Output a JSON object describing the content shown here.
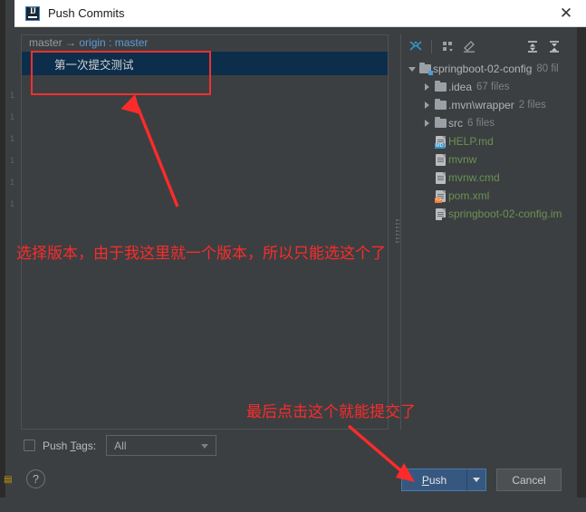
{
  "window": {
    "title": "Push Commits",
    "app_icon": "intellij-idea-icon",
    "close_label": "✕"
  },
  "commits_panel": {
    "branch_source": "master",
    "branch_arrow": "→",
    "branch_target": "origin : master",
    "commits": [
      {
        "message": "第一次提交测试",
        "selected": true
      }
    ]
  },
  "files_panel": {
    "toolbar": [
      {
        "name": "collapse-selection-icon",
        "label": ""
      },
      {
        "name": "group-by-icon",
        "label": ""
      },
      {
        "name": "edit-icon",
        "label": ""
      },
      {
        "name": "expand-all-icon",
        "label": ""
      },
      {
        "name": "collapse-all-icon",
        "label": ""
      }
    ],
    "tree": [
      {
        "indent": 0,
        "twisty": "open",
        "icon": "folder-module-icon",
        "label": "springboot-02-config",
        "count": "80 fil",
        "color": "gray"
      },
      {
        "indent": 1,
        "twisty": "closed",
        "icon": "folder-icon",
        "label": ".idea",
        "count": "67 files",
        "color": "gray"
      },
      {
        "indent": 1,
        "twisty": "closed",
        "icon": "folder-icon",
        "label": ".mvn\\wrapper",
        "count": "2 files",
        "color": "gray"
      },
      {
        "indent": 1,
        "twisty": "closed",
        "icon": "folder-icon",
        "label": "src",
        "count": "6 files",
        "color": "gray"
      },
      {
        "indent": 1,
        "twisty": "none",
        "icon": "markdown-file-icon",
        "label": "HELP.md",
        "count": "",
        "color": "green"
      },
      {
        "indent": 1,
        "twisty": "none",
        "icon": "text-file-icon",
        "label": "mvnw",
        "count": "",
        "color": "green"
      },
      {
        "indent": 1,
        "twisty": "none",
        "icon": "text-file-icon",
        "label": "mvnw.cmd",
        "count": "",
        "color": "green"
      },
      {
        "indent": 1,
        "twisty": "none",
        "icon": "xml-file-icon",
        "label": "pom.xml",
        "count": "",
        "color": "green"
      },
      {
        "indent": 1,
        "twisty": "none",
        "icon": "iml-file-icon",
        "label": "springboot-02-config.im",
        "count": "",
        "color": "green"
      }
    ]
  },
  "footer": {
    "push_tags_label_pre": "Push ",
    "push_tags_label_mnemonic": "T",
    "push_tags_label_post": "ags:",
    "push_tags_checked": false,
    "tags_combo_value": "All",
    "help_label": "?",
    "push_button": {
      "label_pre": "P",
      "label_post": "ush"
    },
    "cancel_button": "Cancel"
  },
  "annotations": {
    "note_select_version": "选择版本，由于我这里就一个版本，所以只能选这个了",
    "note_click_push": "最后点击这个就能提交了",
    "highlight_color": "#fc2b2b"
  },
  "background": {
    "gutter_numbers": [
      "1",
      "1",
      "1",
      "1",
      "1",
      "1"
    ]
  }
}
